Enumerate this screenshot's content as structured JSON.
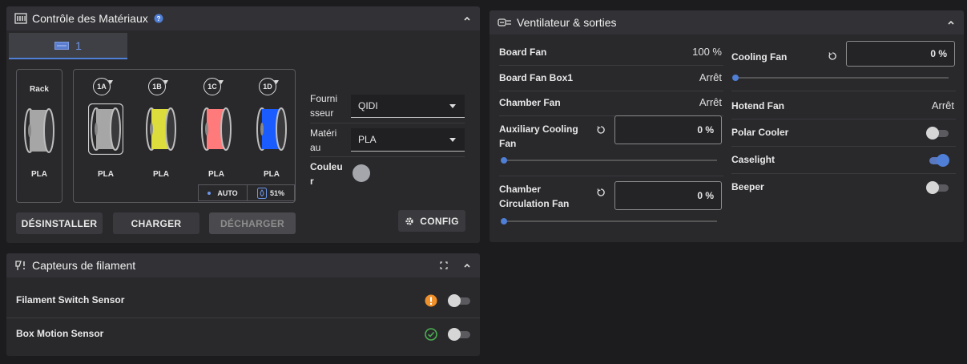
{
  "material_panel": {
    "title": "Contrôle des Matériaux",
    "tab_label": "1",
    "rack": {
      "label": "Rack",
      "material": "PLA"
    },
    "slots": [
      {
        "id": "1A",
        "material": "PLA",
        "color": "#a6a6a6"
      },
      {
        "id": "1B",
        "material": "PLA",
        "color": "#dcdc3c"
      },
      {
        "id": "1C",
        "material": "PLA",
        "color": "#ff7a7a"
      },
      {
        "id": "1D",
        "material": "PLA",
        "color": "#1a5cff"
      }
    ],
    "auto_label": "AUTO",
    "humidity": "51%",
    "fields": {
      "supplier_label": "Fourni\nsseur",
      "supplier_value": "QIDI",
      "material_label": "Matéri\nau",
      "material_value": "PLA",
      "color_label": "Couleu\nr"
    },
    "buttons": {
      "uninstall": "DÉSINSTALLER",
      "load": "CHARGER",
      "unload": "DÉCHARGER",
      "config": "CONFIG"
    }
  },
  "filament_panel": {
    "title": "Capteurs de filament",
    "sensors": [
      {
        "name": "Filament Switch Sensor",
        "status": "warning",
        "enabled": false
      },
      {
        "name": "Box Motion Sensor",
        "status": "ok",
        "enabled": false
      }
    ]
  },
  "fan_panel": {
    "title": "Ventilateur & sorties",
    "left": {
      "board_fan": {
        "label": "Board Fan",
        "value": "100 %"
      },
      "board_fan_box1": {
        "label": "Board Fan Box1",
        "value": "Arrêt"
      },
      "chamber_fan": {
        "label": "Chamber Fan",
        "value": "Arrêt"
      },
      "aux_fan": {
        "label": "Auxiliary Cooling\nFan",
        "value": "0 %",
        "level": 0
      },
      "circ_fan": {
        "label": "Chamber\nCirculation Fan",
        "value": "0 %",
        "level": 0
      }
    },
    "right": {
      "cooling_fan": {
        "label": "Cooling Fan",
        "value": "0 %",
        "level": 0
      },
      "hotend_fan": {
        "label": "Hotend Fan",
        "value": "Arrêt"
      },
      "polar_cooler": {
        "label": "Polar Cooler",
        "on": false
      },
      "caselight": {
        "label": "Caselight",
        "on": true
      },
      "beeper": {
        "label": "Beeper",
        "on": false
      }
    }
  },
  "colors": {
    "accent": "#4f7fd6",
    "warning": "#f0902a",
    "ok": "#4caf50"
  }
}
